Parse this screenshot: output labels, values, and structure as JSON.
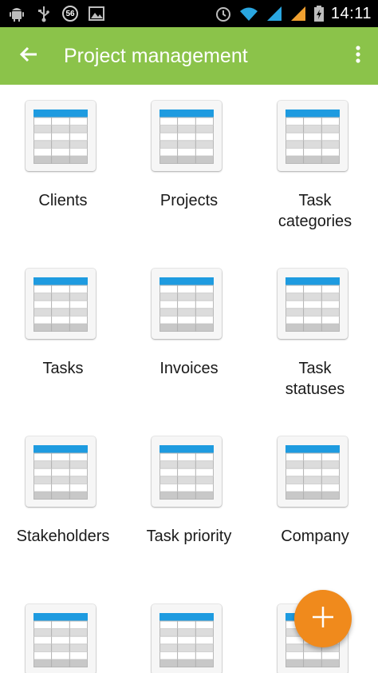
{
  "status_bar": {
    "badge": "56",
    "time": "14:11"
  },
  "app_bar": {
    "title": "Project management"
  },
  "tiles": [
    {
      "label": "Clients"
    },
    {
      "label": "Projects"
    },
    {
      "label": "Task\ncategories"
    },
    {
      "label": "Tasks"
    },
    {
      "label": "Invoices"
    },
    {
      "label": "Task\nstatuses"
    },
    {
      "label": "Stakeholders"
    },
    {
      "label": "Task priority"
    },
    {
      "label": "Company"
    },
    {
      "label": ""
    },
    {
      "label": ""
    },
    {
      "label": ""
    }
  ],
  "colors": {
    "app_bar": "#8bc34a",
    "fab": "#f08a1c",
    "table_header": "#1e9be0"
  },
  "icons": {
    "back": "arrow-back-icon",
    "menu": "more-vert-icon",
    "tile": "table-icon",
    "fab": "plus-icon"
  }
}
